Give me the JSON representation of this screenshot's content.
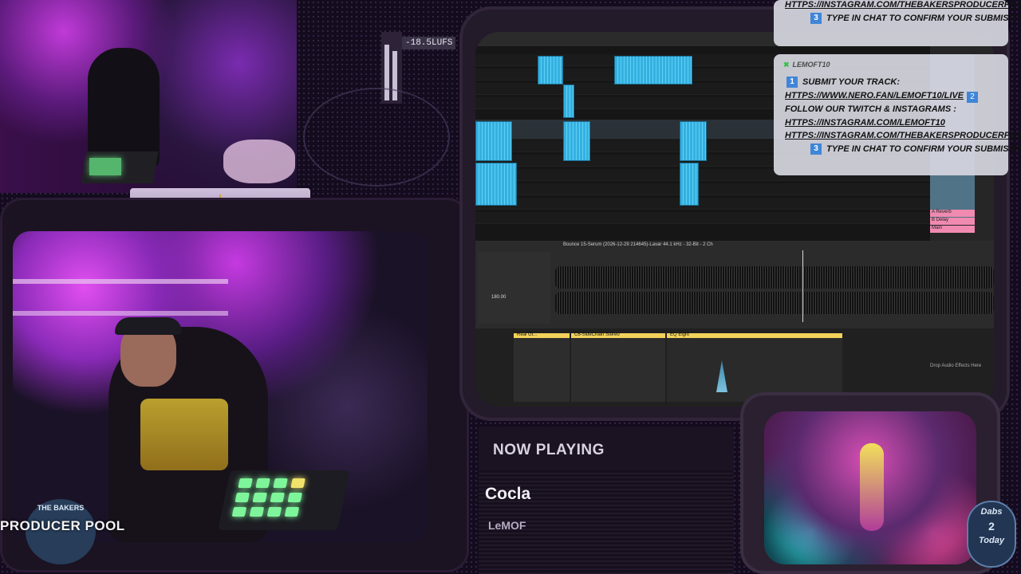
{
  "overlay": {
    "producer_pool_top": "THE BAKERS",
    "producer_pool_main": "PRODUCER POOL",
    "lufs": "-18.5LUFS",
    "dabs_top": "Dabs",
    "dabs_count": "2",
    "dabs_bottom": "Today"
  },
  "chat": {
    "card1": {
      "line1": "HTTPS://INSTAGRAM.COM/THEBAKERSPRODUCERPOOL",
      "step3_num": "3",
      "step3": "TYPE IN CHAT TO CONFIRM YOUR SUBMISSION"
    },
    "card2": {
      "user": "LEMOFT10",
      "step1_num": "1",
      "step1": "SUBMIT YOUR TRACK:",
      "link1": "HTTPS://WWW.NERO.FAN/LEMOFT10/LIVE",
      "step2_num": "2",
      "step2": "FOLLOW OUR TWITCH & INSTAGRAMS :",
      "link2": "HTTPS://INSTAGRAM.COM/LEMOFT10",
      "link3": "HTTPS://INSTAGRAM.COM/THEBAKERSPRODUCERPOOL",
      "step3_num": "3",
      "step3": "TYPE IN CHAT TO CONFIRM YOUR SUBMISSION"
    }
  },
  "now_playing": {
    "heading": "NOW PLAYING",
    "title": "Cocla",
    "artist": "LeMOF"
  },
  "daw": {
    "clip_name": "Bounce 15-Serum (2026-12-29 214645)-Lavar 44.1 kHz - 32-Bit - 2 Ch",
    "tempo": "180.00",
    "devices": [
      "Real Gl...",
      "C6-SideChain Stereo",
      "EQ Eight"
    ],
    "mixer": [
      "A Reverb",
      "B Delay",
      "Main"
    ],
    "drop_hint": "Drop Audio Effects Here"
  }
}
